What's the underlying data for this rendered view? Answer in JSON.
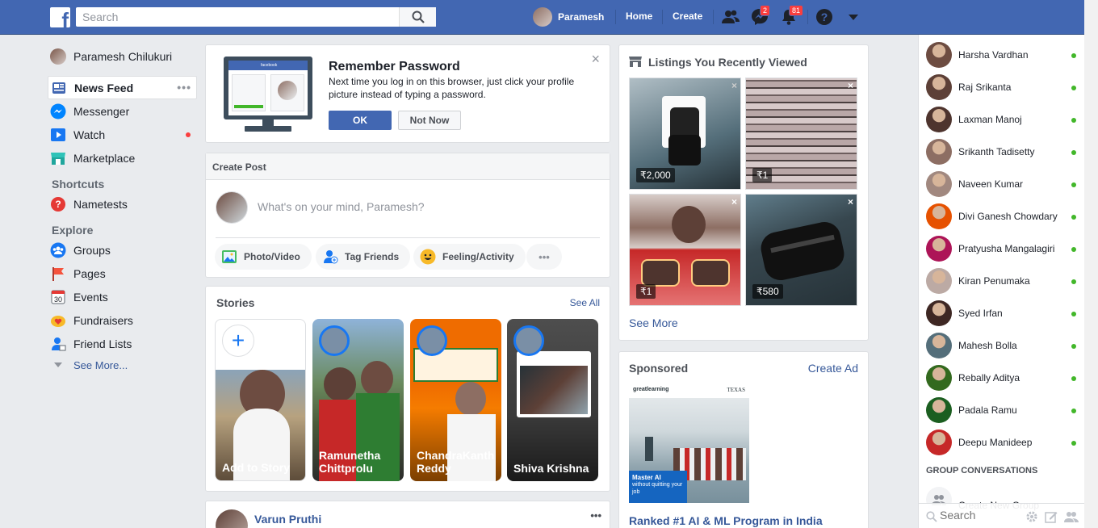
{
  "topbar": {
    "logo": "f",
    "search_placeholder": "Search",
    "profile_name": "Paramesh",
    "home": "Home",
    "create": "Create",
    "messages_badge": "2",
    "notifications_badge": "81"
  },
  "left_nav": {
    "profile_name": "Paramesh Chilukuri",
    "items": [
      {
        "label": "News Feed"
      },
      {
        "label": "Messenger"
      },
      {
        "label": "Watch"
      },
      {
        "label": "Marketplace"
      }
    ],
    "shortcuts_heading": "Shortcuts",
    "shortcuts": [
      {
        "label": "Nametests"
      }
    ],
    "explore_heading": "Explore",
    "explore": [
      {
        "label": "Groups"
      },
      {
        "label": "Pages"
      },
      {
        "label": "Events",
        "icon_text": "30"
      },
      {
        "label": "Fundraisers"
      },
      {
        "label": "Friend Lists"
      }
    ],
    "see_more": "See More..."
  },
  "remember": {
    "title": "Remember Password",
    "body": "Next time you log in on this browser, just click your profile picture instead of typing a password.",
    "ok": "OK",
    "not_now": "Not Now",
    "close": "×",
    "illustration_brand": "facebook"
  },
  "create_post": {
    "header": "Create Post",
    "placeholder": "What's on your mind, Paramesh?",
    "photo": "Photo/Video",
    "tag": "Tag Friends",
    "feeling": "Feeling/Activity",
    "more": "•••"
  },
  "stories": {
    "title": "Stories",
    "see_all": "See All",
    "items": [
      {
        "name": "Add to Story"
      },
      {
        "name": "Ramunetha Chittprolu"
      },
      {
        "name": "ChandraKanth Reddy"
      },
      {
        "name": "Shiva Krishna"
      }
    ]
  },
  "post": {
    "author": "Varun Pruthi",
    "more": "•••"
  },
  "listings": {
    "title": "Listings You Recently Viewed",
    "items": [
      {
        "price": "₹2,000"
      },
      {
        "price": "₹1"
      },
      {
        "price": "₹1"
      },
      {
        "price": "₹580"
      }
    ],
    "see_more": "See More"
  },
  "sponsored": {
    "title": "Sponsored",
    "create_ad": "Create Ad",
    "ad_logo": "greatlearning",
    "ad_partner": "TEXAS",
    "ad_overlay_title": "Master AI",
    "ad_overlay_sub": "without quitting your job",
    "ad_headline": "Ranked #1 AI & ML Program in India"
  },
  "contacts": {
    "items": [
      {
        "name": "Harsha Vardhan",
        "color": "#6d4c41"
      },
      {
        "name": "Raj Srikanta",
        "color": "#5d4037"
      },
      {
        "name": "Laxman Manoj",
        "color": "#4e342e"
      },
      {
        "name": "Srikanth Tadisetty",
        "color": "#8d6e63"
      },
      {
        "name": "Naveen Kumar",
        "color": "#a1887f"
      },
      {
        "name": "Divi Ganesh Chowdary",
        "color": "#e65100"
      },
      {
        "name": "Pratyusha Mangalagiri",
        "color": "#ad1457"
      },
      {
        "name": "Kiran Penumaka",
        "color": "#bcaaa4"
      },
      {
        "name": "Syed Irfan",
        "color": "#3e2723"
      },
      {
        "name": "Mahesh Bolla",
        "color": "#546e7a"
      },
      {
        "name": "Rebally Aditya",
        "color": "#33691e"
      },
      {
        "name": "Padala Ramu",
        "color": "#1b5e20"
      },
      {
        "name": "Deepu Manideep",
        "color": "#c62828"
      }
    ],
    "group_heading": "GROUP CONVERSATIONS",
    "create_group": "Create New Group",
    "search_placeholder": "Search"
  }
}
